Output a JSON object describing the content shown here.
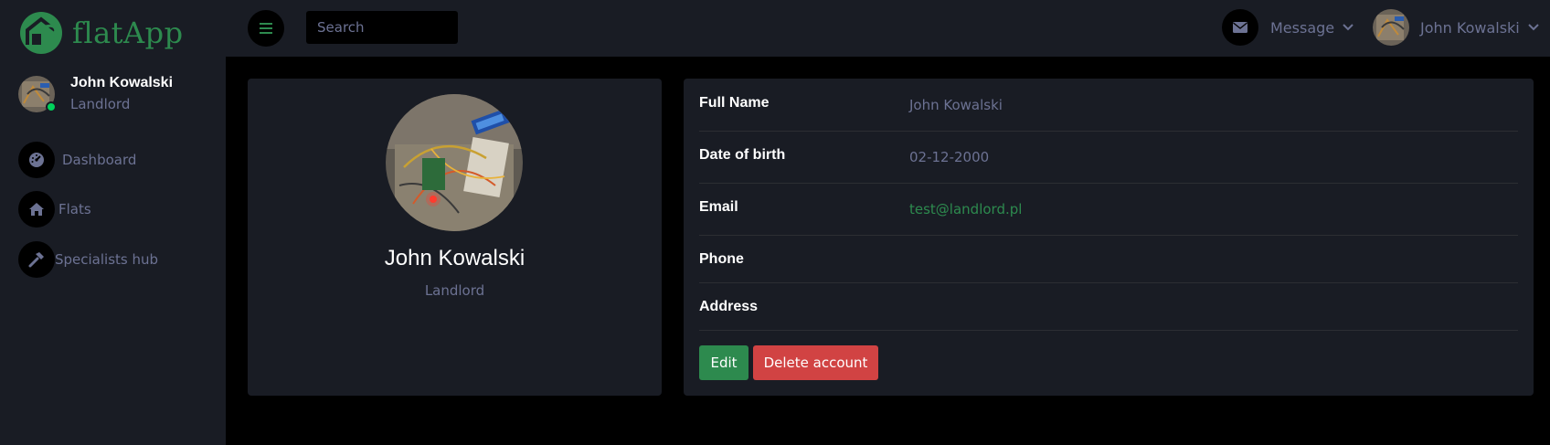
{
  "brand": {
    "name": "flatApp",
    "accent": "#2d8a4e"
  },
  "sidebar": {
    "profile": {
      "name": "John Kowalski",
      "role": "Landlord",
      "status_color": "#00d25b"
    },
    "items": [
      {
        "label": "Dashboard",
        "icon": "speedometer-icon"
      },
      {
        "label": "Flats",
        "icon": "home-icon"
      },
      {
        "label": "Specialists hub",
        "icon": "hammer-icon"
      }
    ]
  },
  "topbar": {
    "menu_icon": "hamburger-icon",
    "search": {
      "placeholder": "Search",
      "value": ""
    },
    "message": {
      "label": "Message",
      "icon": "envelope-icon"
    },
    "user": {
      "name": "John Kowalski"
    }
  },
  "profile_card": {
    "name": "John Kowalski",
    "role": "Landlord"
  },
  "details": {
    "rows": [
      {
        "label": "Full Name",
        "value": "John Kowalski"
      },
      {
        "label": "Date of birth",
        "value": "02-12-2000"
      },
      {
        "label": "Email",
        "value": "test@landlord.pl"
      },
      {
        "label": "Phone",
        "value": ""
      },
      {
        "label": "Address",
        "value": ""
      }
    ],
    "edit_label": "Edit",
    "delete_label": "Delete account"
  },
  "colors": {
    "background": "#000000",
    "panel": "#191c24",
    "muted_text": "#6c7293",
    "danger": "#d14343"
  }
}
